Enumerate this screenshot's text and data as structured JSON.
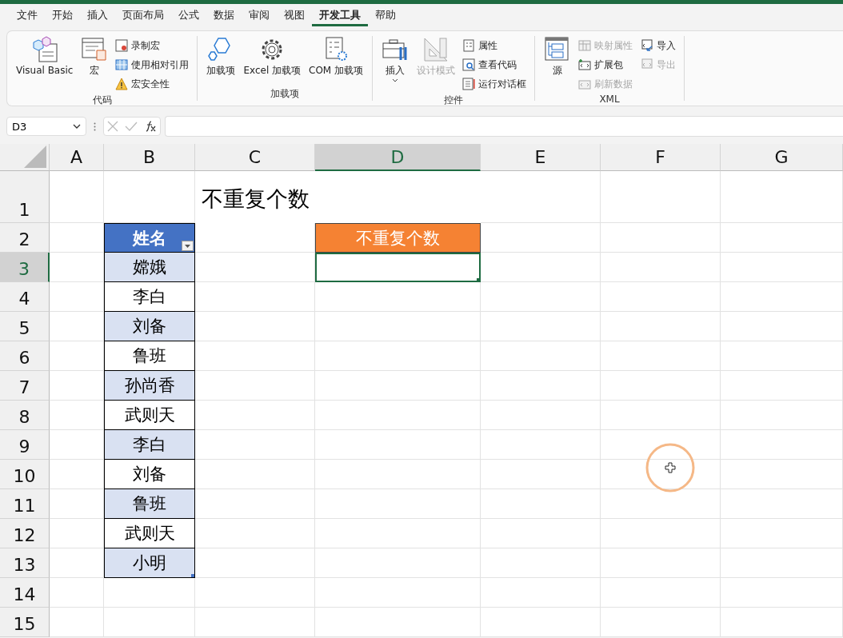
{
  "tabs": [
    {
      "label": "文件",
      "selected": false
    },
    {
      "label": "开始",
      "selected": false
    },
    {
      "label": "插入",
      "selected": false
    },
    {
      "label": "页面布局",
      "selected": false
    },
    {
      "label": "公式",
      "selected": false
    },
    {
      "label": "数据",
      "selected": false
    },
    {
      "label": "审阅",
      "selected": false
    },
    {
      "label": "视图",
      "selected": false
    },
    {
      "label": "开发工具",
      "selected": true
    },
    {
      "label": "帮助",
      "selected": false
    }
  ],
  "ribbon": [
    {
      "label": "代码",
      "items": [
        {
          "kind": "large",
          "label": "Visual Basic",
          "disabled": false
        },
        {
          "kind": "large",
          "label": "宏",
          "disabled": false
        },
        {
          "kind": "small",
          "label": "录制宏",
          "disabled": false
        },
        {
          "kind": "small",
          "label": "使用相对引用",
          "disabled": false
        },
        {
          "kind": "small",
          "label": "宏安全性",
          "disabled": false
        }
      ]
    },
    {
      "label": "加载项",
      "items": [
        {
          "kind": "large",
          "label": "加载项",
          "disabled": false
        },
        {
          "kind": "large",
          "label": "Excel 加载项",
          "disabled": false
        },
        {
          "kind": "large",
          "label": "COM 加载项",
          "disabled": false
        }
      ]
    },
    {
      "label": "控件",
      "items": [
        {
          "kind": "large",
          "label": "插入",
          "disabled": false,
          "caret": true
        },
        {
          "kind": "large",
          "label": "设计模式",
          "disabled": true
        },
        {
          "kind": "small",
          "label": "属性",
          "disabled": false
        },
        {
          "kind": "small",
          "label": "查看代码",
          "disabled": false
        },
        {
          "kind": "small",
          "label": "运行对话框",
          "disabled": false
        }
      ]
    },
    {
      "label": "XML",
      "items": [
        {
          "kind": "large",
          "label": "源",
          "disabled": false
        },
        {
          "kind": "small",
          "label": "映射属性",
          "disabled": true
        },
        {
          "kind": "small",
          "label": "扩展包",
          "disabled": false
        },
        {
          "kind": "small",
          "label": "刷新数据",
          "disabled": true
        },
        {
          "kind": "small",
          "label": "导入",
          "disabled": false
        },
        {
          "kind": "small",
          "label": "导出",
          "disabled": true
        }
      ]
    }
  ],
  "name_box": {
    "value": "D3"
  },
  "columns": [
    {
      "label": "A",
      "selected": false
    },
    {
      "label": "B",
      "selected": false
    },
    {
      "label": "C",
      "selected": false
    },
    {
      "label": "D",
      "selected": true
    },
    {
      "label": "E",
      "selected": false
    },
    {
      "label": "F",
      "selected": false
    },
    {
      "label": "G",
      "selected": false
    }
  ],
  "rows": [
    {
      "label": "1",
      "selected": false
    },
    {
      "label": "2",
      "selected": false
    },
    {
      "label": "3",
      "selected": true
    },
    {
      "label": "4",
      "selected": false
    },
    {
      "label": "5",
      "selected": false
    },
    {
      "label": "6",
      "selected": false
    },
    {
      "label": "7",
      "selected": false
    },
    {
      "label": "8",
      "selected": false
    },
    {
      "label": "9",
      "selected": false
    },
    {
      "label": "10",
      "selected": false
    },
    {
      "label": "11",
      "selected": false
    },
    {
      "label": "12",
      "selected": false
    },
    {
      "label": "13",
      "selected": false
    },
    {
      "label": "14",
      "selected": false
    },
    {
      "label": "15",
      "selected": false
    }
  ],
  "title": "不重复个数",
  "name_table": {
    "header": "姓名",
    "rows": [
      {
        "value": "嫦娥",
        "banded": true
      },
      {
        "value": "李白",
        "banded": false
      },
      {
        "value": "刘备",
        "banded": true
      },
      {
        "value": "鲁班",
        "banded": false
      },
      {
        "value": "孙尚香",
        "banded": true
      },
      {
        "value": "武则天",
        "banded": false
      },
      {
        "value": "李白",
        "banded": true
      },
      {
        "value": "刘备",
        "banded": false
      },
      {
        "value": "鲁班",
        "banded": true
      },
      {
        "value": "武则天",
        "banded": false
      },
      {
        "value": "小明",
        "banded": true
      }
    ]
  },
  "result": {
    "header": "不重复个数",
    "selected": true
  }
}
